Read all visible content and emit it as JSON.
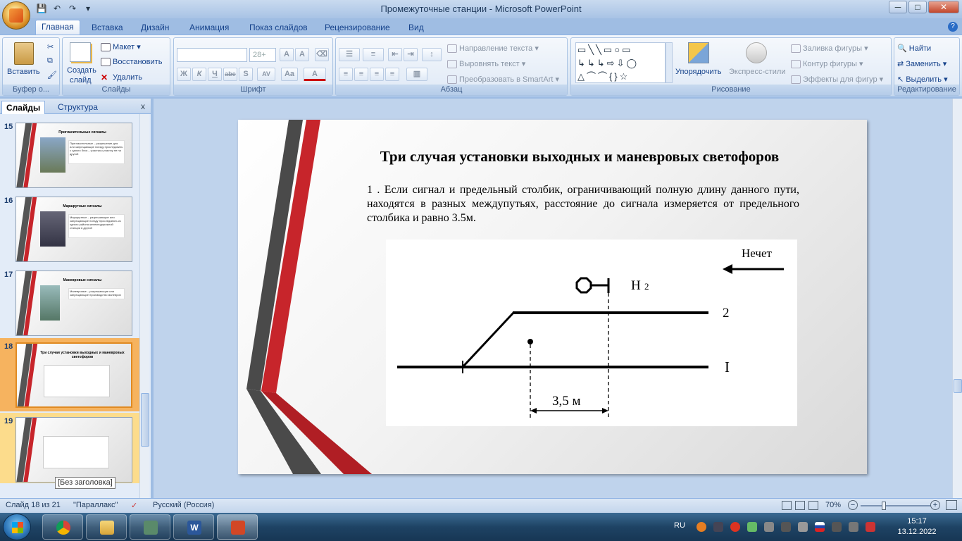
{
  "window": {
    "title": "Промежуточные станции - Microsoft PowerPoint",
    "controls": [
      "─",
      "□",
      "✕"
    ]
  },
  "ribbon_tabs": [
    "Главная",
    "Вставка",
    "Дизайн",
    "Анимация",
    "Показ слайдов",
    "Рецензирование",
    "Вид"
  ],
  "ribbon": {
    "clipboard": {
      "paste": "Вставить",
      "label": "Буфер о..."
    },
    "slides": {
      "create": "Создать",
      "create2": "слайд",
      "layout": "Макет",
      "reset": "Восстановить",
      "delete": "Удалить",
      "label": "Слайды"
    },
    "font": {
      "font_name": "",
      "font_size": "28+",
      "label": "Шрифт",
      "bold": "Ж",
      "italic": "К",
      "underline": "Ч",
      "strike": "abe",
      "shadow": "S",
      "spacing": "AV",
      "case": "Aa",
      "color": "A"
    },
    "paragraph": {
      "text_dir": "Направление текста",
      "align_text": "Выровнять текст",
      "smartart": "Преобразовать в SmartArt",
      "label": "Абзац"
    },
    "drawing": {
      "arrange": "Упорядочить",
      "styles": "Экспресс-стили",
      "fill": "Заливка фигуры",
      "outline": "Контур фигуры",
      "effects": "Эффекты для фигур",
      "label": "Рисование"
    },
    "editing": {
      "find": "Найти",
      "replace": "Заменить",
      "select": "Выделить",
      "label": "Редактирование"
    }
  },
  "panel": {
    "tab_slides": "Слайды",
    "tab_outline": "Структура",
    "thumbnails": [
      {
        "num": "15",
        "title": "Пригласительные сигналы",
        "caption": "Пригласительные – разрешение для или запрещающие поезду проследовать с одного блок – участка к участку не на другой"
      },
      {
        "num": "16",
        "title": "Маршрутные сигналы",
        "caption": "Маршрутные – разрешающие или запрещающие поезду проследовать из одного района железнодорожной станции в другой"
      },
      {
        "num": "17",
        "title": "Маневровые сигналы",
        "caption": "Маневровые – разрешающие или запрещающие производство маневров"
      },
      {
        "num": "18",
        "title": "Три случая установки выходных и маневровых светофоров",
        "caption": ""
      },
      {
        "num": "19",
        "title": "",
        "caption": ""
      }
    ],
    "tooltip": "[Без заголовка]"
  },
  "slide": {
    "title": "Три случая установки выходных и маневровых светофоров",
    "body": "1 . Если сигнал и предельный столбик, ограничивающий полную длину данного пути, находятся в разных междупутьях, расстояние до сигнала измеряется от предельного столбика и равно 3.5м.",
    "diagram": {
      "direction_label": "Нечет",
      "signal_label": "Н",
      "signal_sub": "2",
      "track_upper": "2",
      "track_lower": "I",
      "distance_label": "3,5 м"
    }
  },
  "status": {
    "slide_counter": "Слайд 18 из 21",
    "theme": "\"Параллакс\"",
    "language": "Русский (Россия)",
    "zoom": "70%",
    "zoom_level": 70
  },
  "taskbar": {
    "lang": "RU",
    "time": "15:17",
    "date": "13.12.2022"
  },
  "colors": {
    "accent_red": "#c7252b",
    "stripe_dark": "#4a4a4a",
    "ribbon_text": "#15428b"
  }
}
